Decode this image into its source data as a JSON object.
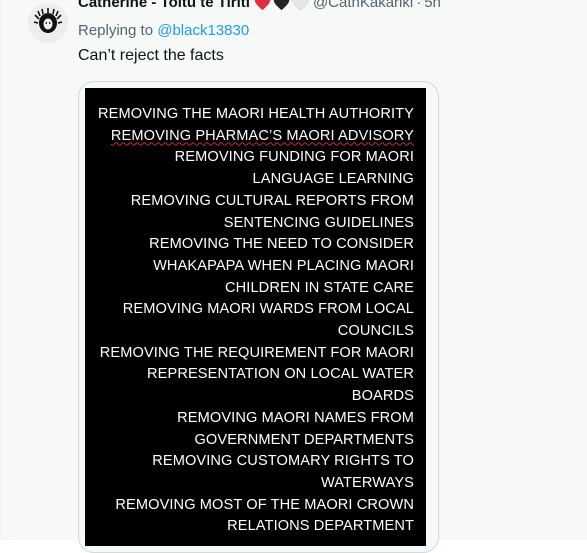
{
  "tweet": {
    "display_name": "Catherine - Toitu te Tiriti",
    "emoji_icons": [
      "red-heart-icon",
      "black-heart-icon",
      "white-heart-icon"
    ],
    "colors": {
      "red_heart": "#dd2e44",
      "black_heart": "#222222",
      "white_heart": "#e6e6e6"
    },
    "handle": "@CathKakariki",
    "separator": "·",
    "time": "5h",
    "replying_prefix": "Replying to",
    "replying_to": "@black13830",
    "text": "Can’t reject the facts",
    "media_lines": [
      "REMOVING THE MAORI HEALTH AUTHORITY",
      "REMOVING PHARMAC’S MAORI ADVISORY",
      "REMOVING FUNDING FOR MAORI",
      "LANGUAGE LEARNING",
      "REMOVING CULTURAL REPORTS FROM",
      "SENTENCING GUIDELINES",
      "REMOVING THE NEED TO CONSIDER",
      "WHAKAPAPA WHEN PLACING MAORI",
      "CHILDREN IN STATE CARE",
      "REMOVING MAORI WARDS FROM LOCAL",
      "COUNCILS",
      "REMOVING THE REQUIREMENT FOR MAORI",
      "REPRESENTATION ON LOCAL WATER",
      "BOARDS",
      "REMOVING MAORI NAMES FROM",
      "GOVERNMENT DEPARTMENTS",
      "REMOVING CUSTOMARY RIGHTS TO",
      "WATERWAYS",
      "REMOVING MOST OF THE MAORI CROWN",
      "RELATIONS DEPARTMENT"
    ]
  }
}
